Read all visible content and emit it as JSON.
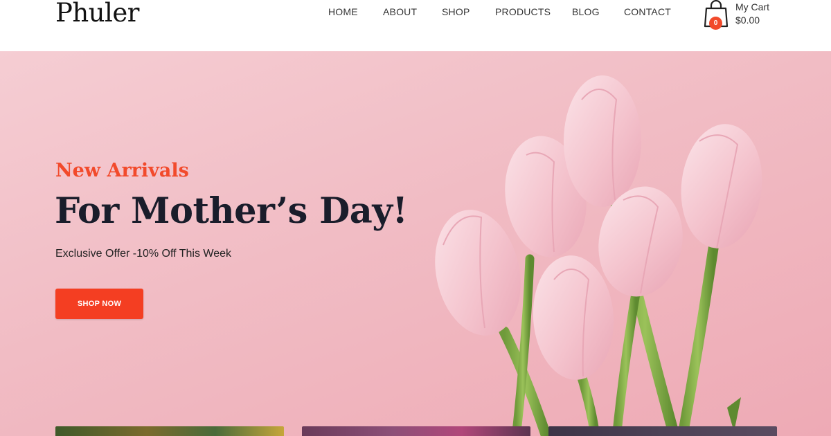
{
  "header": {
    "logo": "Phuler",
    "nav": [
      "HOME",
      "ABOUT",
      "SHOP",
      "PRODUCTS",
      "BLOG",
      "CONTACT"
    ],
    "cart": {
      "icon": "shopping-bag-icon",
      "count": "0",
      "label": "My Cart",
      "total": "$0.00"
    }
  },
  "hero": {
    "subtitle": "New Arrivals",
    "title": "For Mother’s Day!",
    "offer": "Exclusive Offer -10% Off This Week",
    "button_label": "SHOP NOW"
  },
  "colors": {
    "accent": "#f43e22",
    "hero_background": "#f1bcc4",
    "title_text": "#1a1d2b"
  }
}
